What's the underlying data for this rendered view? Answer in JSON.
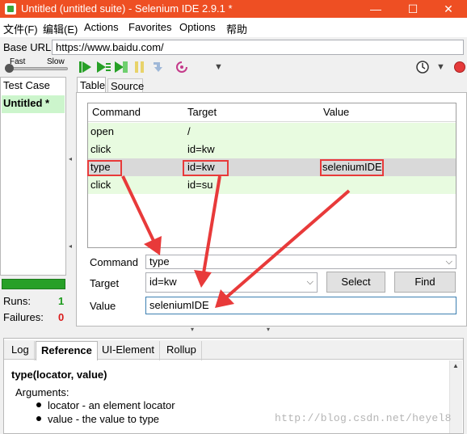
{
  "window": {
    "title": "Untitled (untitled suite) - Selenium IDE 2.9.1 *",
    "buttons": {
      "minimize": "—",
      "maximize": "☐",
      "close": "✕"
    }
  },
  "menu": [
    "文件(F)",
    "编辑(E)",
    "Actions",
    "Favorites",
    "Options",
    "帮助"
  ],
  "base_url": {
    "label": "Base URL",
    "value": "https://www.baidu.com/"
  },
  "toolbar": {
    "fast": "Fast",
    "slow": "Slow",
    "speed_level": 0
  },
  "test_case": {
    "header": "Test Case",
    "items": [
      "Untitled *"
    ]
  },
  "stats": {
    "runs_label": "Runs:",
    "runs": "1",
    "failures_label": "Failures:",
    "failures": "0",
    "progress": 1.0
  },
  "tabs": {
    "table": "Table",
    "source": "Source"
  },
  "table": {
    "headers": [
      "Command",
      "Target",
      "Value"
    ],
    "rows": [
      {
        "command": "open",
        "target": "/",
        "value": ""
      },
      {
        "command": "click",
        "target": "id=kw",
        "value": ""
      },
      {
        "command": "type",
        "target": "id=kw",
        "value": "seleniumIDE"
      },
      {
        "command": "click",
        "target": "id=su",
        "value": ""
      }
    ]
  },
  "editor": {
    "command_label": "Command",
    "command_value": "type",
    "target_label": "Target",
    "target_value": "id=kw",
    "select_button": "Select",
    "find_button": "Find",
    "value_label": "Value",
    "value_value": "seleniumIDE"
  },
  "bottom_tabs": [
    "Log",
    "Reference",
    "UI-Element",
    "Rollup"
  ],
  "reference": {
    "signature": "type(locator, value)",
    "arguments_label": "Arguments:",
    "args": [
      "locator - an element locator",
      "value - the value to type"
    ]
  },
  "watermark": "http://blog.csdn.net/heyel8",
  "colors": {
    "titlebar": "#ee4f23",
    "executed_row": "#e8fbe0",
    "selected_row": "#d9d9d9",
    "annotation": "#e83a3a",
    "pass": "#27a027"
  }
}
